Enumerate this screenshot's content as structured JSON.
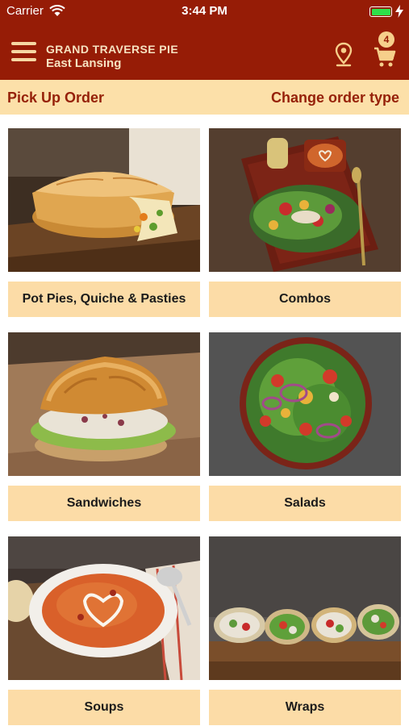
{
  "status_bar": {
    "carrier": "Carrier",
    "time": "3:44 PM",
    "wifi_icon": "wifi-icon",
    "battery_icon": "battery-icon",
    "charging_icon": "lightning-bolt-icon"
  },
  "header": {
    "store_name": "GRAND TRAVERSE PIE",
    "store_location": "East Lansing",
    "menu_icon": "hamburger-menu-icon",
    "location_icon": "map-pin-icon",
    "cart_icon": "shopping-cart-icon",
    "cart_count": "4"
  },
  "order_type": {
    "label": "Pick Up Order",
    "change_label": "Change order type"
  },
  "categories": [
    {
      "label": "Pot Pies, Quiche & Pasties"
    },
    {
      "label": "Combos"
    },
    {
      "label": "Sandwiches"
    },
    {
      "label": "Salads"
    },
    {
      "label": "Soups"
    },
    {
      "label": "Wraps"
    }
  ],
  "colors": {
    "header_bg": "#961c06",
    "accent_strip": "#fce0a9",
    "accent_text": "#962109",
    "tile_label_bg": "#fcdca7"
  }
}
